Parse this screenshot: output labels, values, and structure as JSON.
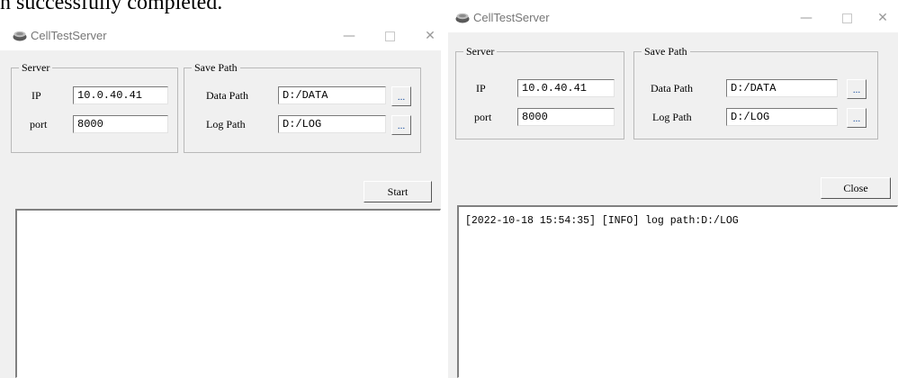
{
  "caption": "n successfully completed.",
  "icons": {
    "app": "cell-server-app-icon",
    "minimize": "minimize-icon",
    "maximize": "maximize-icon",
    "close": "close-icon",
    "browse": "ellipsis-icon"
  },
  "windows": [
    {
      "title": "CellTestServer",
      "controls": {
        "minimize": "—",
        "close": "✕"
      },
      "server_group": {
        "legend": "Server",
        "ip_label": "IP",
        "ip_value": "10.0.40.41",
        "port_label": "port",
        "port_value": "8000"
      },
      "save_group": {
        "legend": "Save Path",
        "data_label": "Data Path",
        "data_value": "D:/DATA",
        "log_label": "Log Path",
        "log_value": "D:/LOG",
        "browse_label": "..."
      },
      "action_label": "Start",
      "log_text": ""
    },
    {
      "title": "CellTestServer",
      "controls": {
        "minimize": "—",
        "close": "✕"
      },
      "server_group": {
        "legend": "Server",
        "ip_label": "IP",
        "ip_value": "10.0.40.41",
        "port_label": "port",
        "port_value": "8000"
      },
      "save_group": {
        "legend": "Save Path",
        "data_label": "Data Path",
        "data_value": "D:/DATA",
        "log_label": "Log Path",
        "log_value": "D:/LOG",
        "browse_label": "..."
      },
      "action_label": "Close",
      "log_text": "[2022-10-18 15:54:35] [INFO] log path:D:/LOG"
    }
  ]
}
